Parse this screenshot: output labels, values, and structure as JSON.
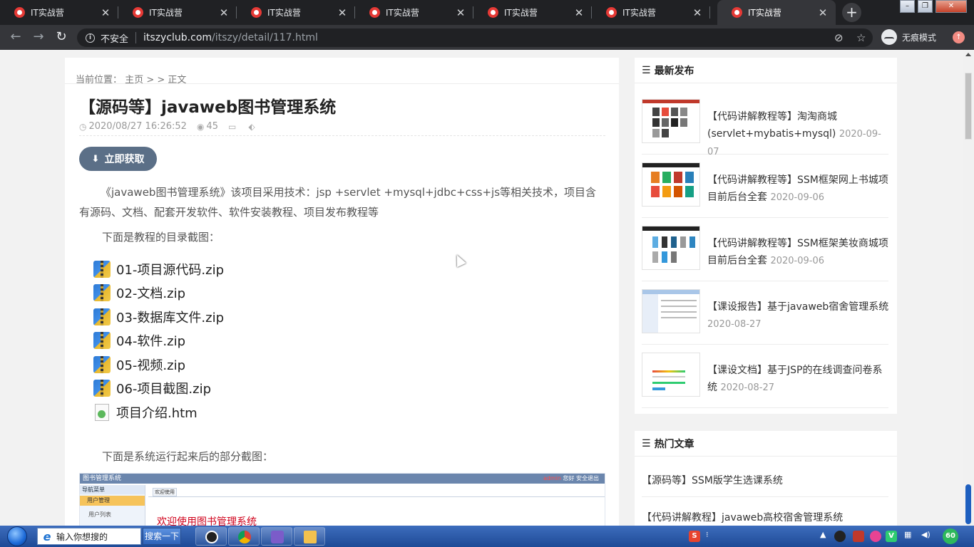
{
  "browser": {
    "tabs": [
      {
        "title": "IT实战营"
      },
      {
        "title": "IT实战营"
      },
      {
        "title": "IT实战营"
      },
      {
        "title": "IT实战营"
      },
      {
        "title": "IT实战营"
      },
      {
        "title": "IT实战营"
      },
      {
        "title": "IT实战营"
      }
    ],
    "active_tab_index": 6,
    "new_tab_label": "+",
    "close_glyph": "✕",
    "address": {
      "security_label": "不安全",
      "host": "itszyclub.com",
      "path": "/itszy/detail/117.html"
    },
    "incognito_label": "无痕模式"
  },
  "article": {
    "breadcrumb": {
      "prefix": "当前位置：",
      "home": "主页",
      "sep1": ">",
      "sep2": ">",
      "current": "正文"
    },
    "title": "【源码等】javaweb图书管理系统",
    "date": "2020/08/27 16:26:52",
    "views": "45",
    "download_label": "立即获取",
    "intro": "《javaweb图书管理系统》该项目采用技术：jsp +servlet +mysql+jdbc+css+js等相关技术，项目含有源码、文档、配套开发软件、软件安装教程、项目发布教程等",
    "toc_heading": "下面是教程的目录截图：",
    "files": [
      {
        "name": "01-项目源代码.zip",
        "icon": "zip-icon"
      },
      {
        "name": "02-文档.zip",
        "icon": "zip-icon"
      },
      {
        "name": "03-数据库文件.zip",
        "icon": "zip-icon"
      },
      {
        "name": "04-软件.zip",
        "icon": "zip-icon"
      },
      {
        "name": "05-视频.zip",
        "icon": "zip-icon"
      },
      {
        "name": "06-项目截图.zip",
        "icon": "zip-icon"
      },
      {
        "name": "项目介绍.htm",
        "icon": "htm-icon"
      }
    ],
    "screens_heading": "下面是系统运行起来后的部分截图：",
    "screenshot": {
      "app_title": "图书管理系统",
      "admin": "admin",
      "hello": "您好",
      "logout": "安全退出",
      "nav_title": "导航菜单",
      "menu_group": "用户管理",
      "menu_item": "用户列表",
      "tab": "欢迎使用",
      "welcome": "欢迎使用图书管理系统"
    }
  },
  "sidebar": {
    "latest": {
      "heading": "最新发布",
      "items": [
        {
          "title": "【代码讲解教程等】淘淘商城(servlet+mybatis+mysql)",
          "date": "2020-09-07"
        },
        {
          "title": "【代码讲解教程等】SSM框架网上书城项目前后台全套",
          "date": "2020-09-06"
        },
        {
          "title": "【代码讲解教程等】SSM框架美妆商城项目前后台全套",
          "date": "2020-09-06"
        },
        {
          "title": "【课设报告】基于javaweb宿舍管理系统",
          "date": "2020-08-27"
        },
        {
          "title": "【课设文档】基于JSP的在线调查问卷系统",
          "date": "2020-08-27"
        }
      ]
    },
    "hot": {
      "heading": "热门文章",
      "items": [
        {
          "title": "【源码等】SSM版学生选课系统"
        },
        {
          "title": "【代码讲解教程】javaweb高校宿舍管理系统"
        }
      ]
    }
  },
  "taskbar": {
    "search_placeholder": "输入你想搜的",
    "search_button": "搜索一下",
    "battery_value": "60"
  },
  "colors": {
    "chrome_dark": "#202124",
    "chrome_toolbar": "#35363a",
    "download_button": "#5b6f87",
    "taskbar": "#2a5aa8"
  }
}
